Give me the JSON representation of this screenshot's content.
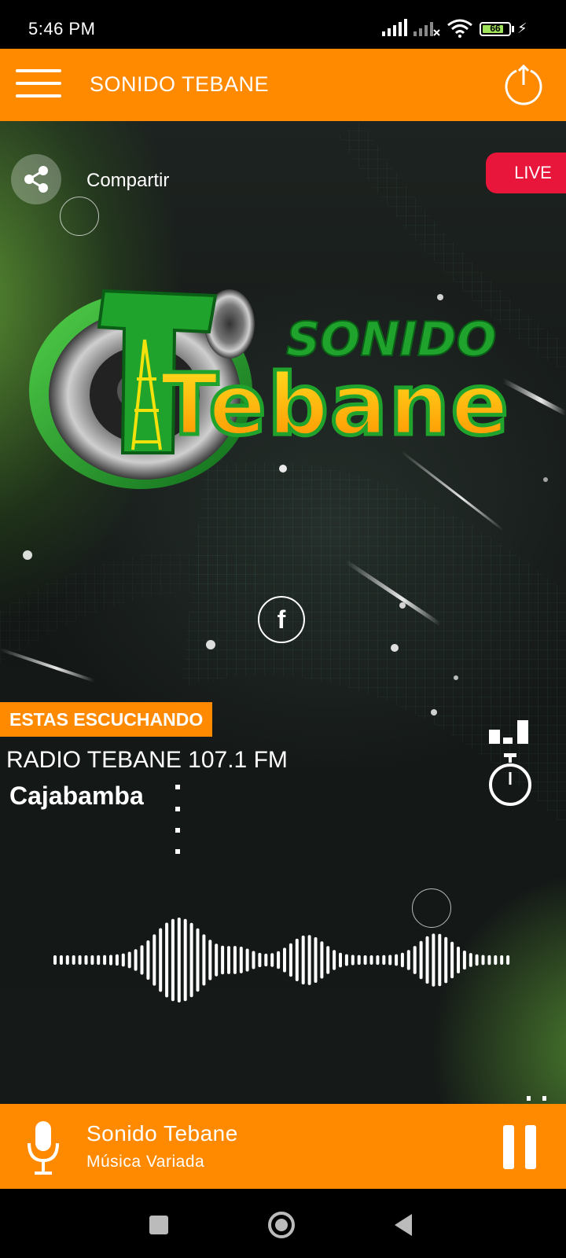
{
  "status_bar": {
    "time": "5:46 PM",
    "battery": "66"
  },
  "app_bar": {
    "title": "SONIDO TEBANE"
  },
  "main": {
    "share_label": "Compartir",
    "live_badge": "LIVE",
    "logo": {
      "top_text": "SONIDO",
      "main_text": "Tebane"
    },
    "facebook_glyph": "f",
    "now_playing_tag": "ESTAS ESCUCHANDO",
    "station_name": "RADIO TEBANE 107.1 FM",
    "city": "Cajabamba"
  },
  "player": {
    "title": "Sonido Tebane",
    "subtitle": "Música Variada"
  },
  "colors": {
    "accent": "#ff8a00",
    "live": "#e8163a",
    "logo_green": "#1fa32c",
    "logo_yellow": "#f2e10a"
  },
  "icons": [
    "menu-icon",
    "power-icon",
    "share-icon",
    "facebook-icon",
    "equalizer-icon",
    "timer-icon",
    "microphone-icon",
    "pause-icon",
    "nav-recents-icon",
    "nav-home-icon",
    "nav-back-icon"
  ]
}
